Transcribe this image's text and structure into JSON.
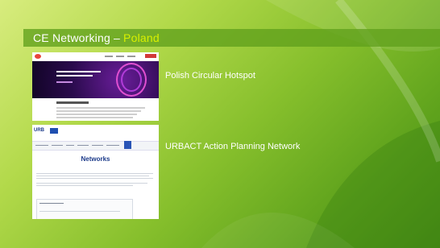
{
  "slide": {
    "title_main": "CE Networking –",
    "title_accent": "Poland"
  },
  "items": [
    {
      "caption": "Polish Circular Hotspot"
    },
    {
      "caption": "URBACT Action Planning Network"
    }
  ],
  "thumbs": {
    "urbact_logo": "URB",
    "urbact_page_title": "Networks"
  },
  "colors": {
    "title_bar": "#60a01c",
    "title_accent": "#d8f000",
    "hero_purple": "#2a0b4d",
    "urbact_blue": "#1d3b8a"
  }
}
